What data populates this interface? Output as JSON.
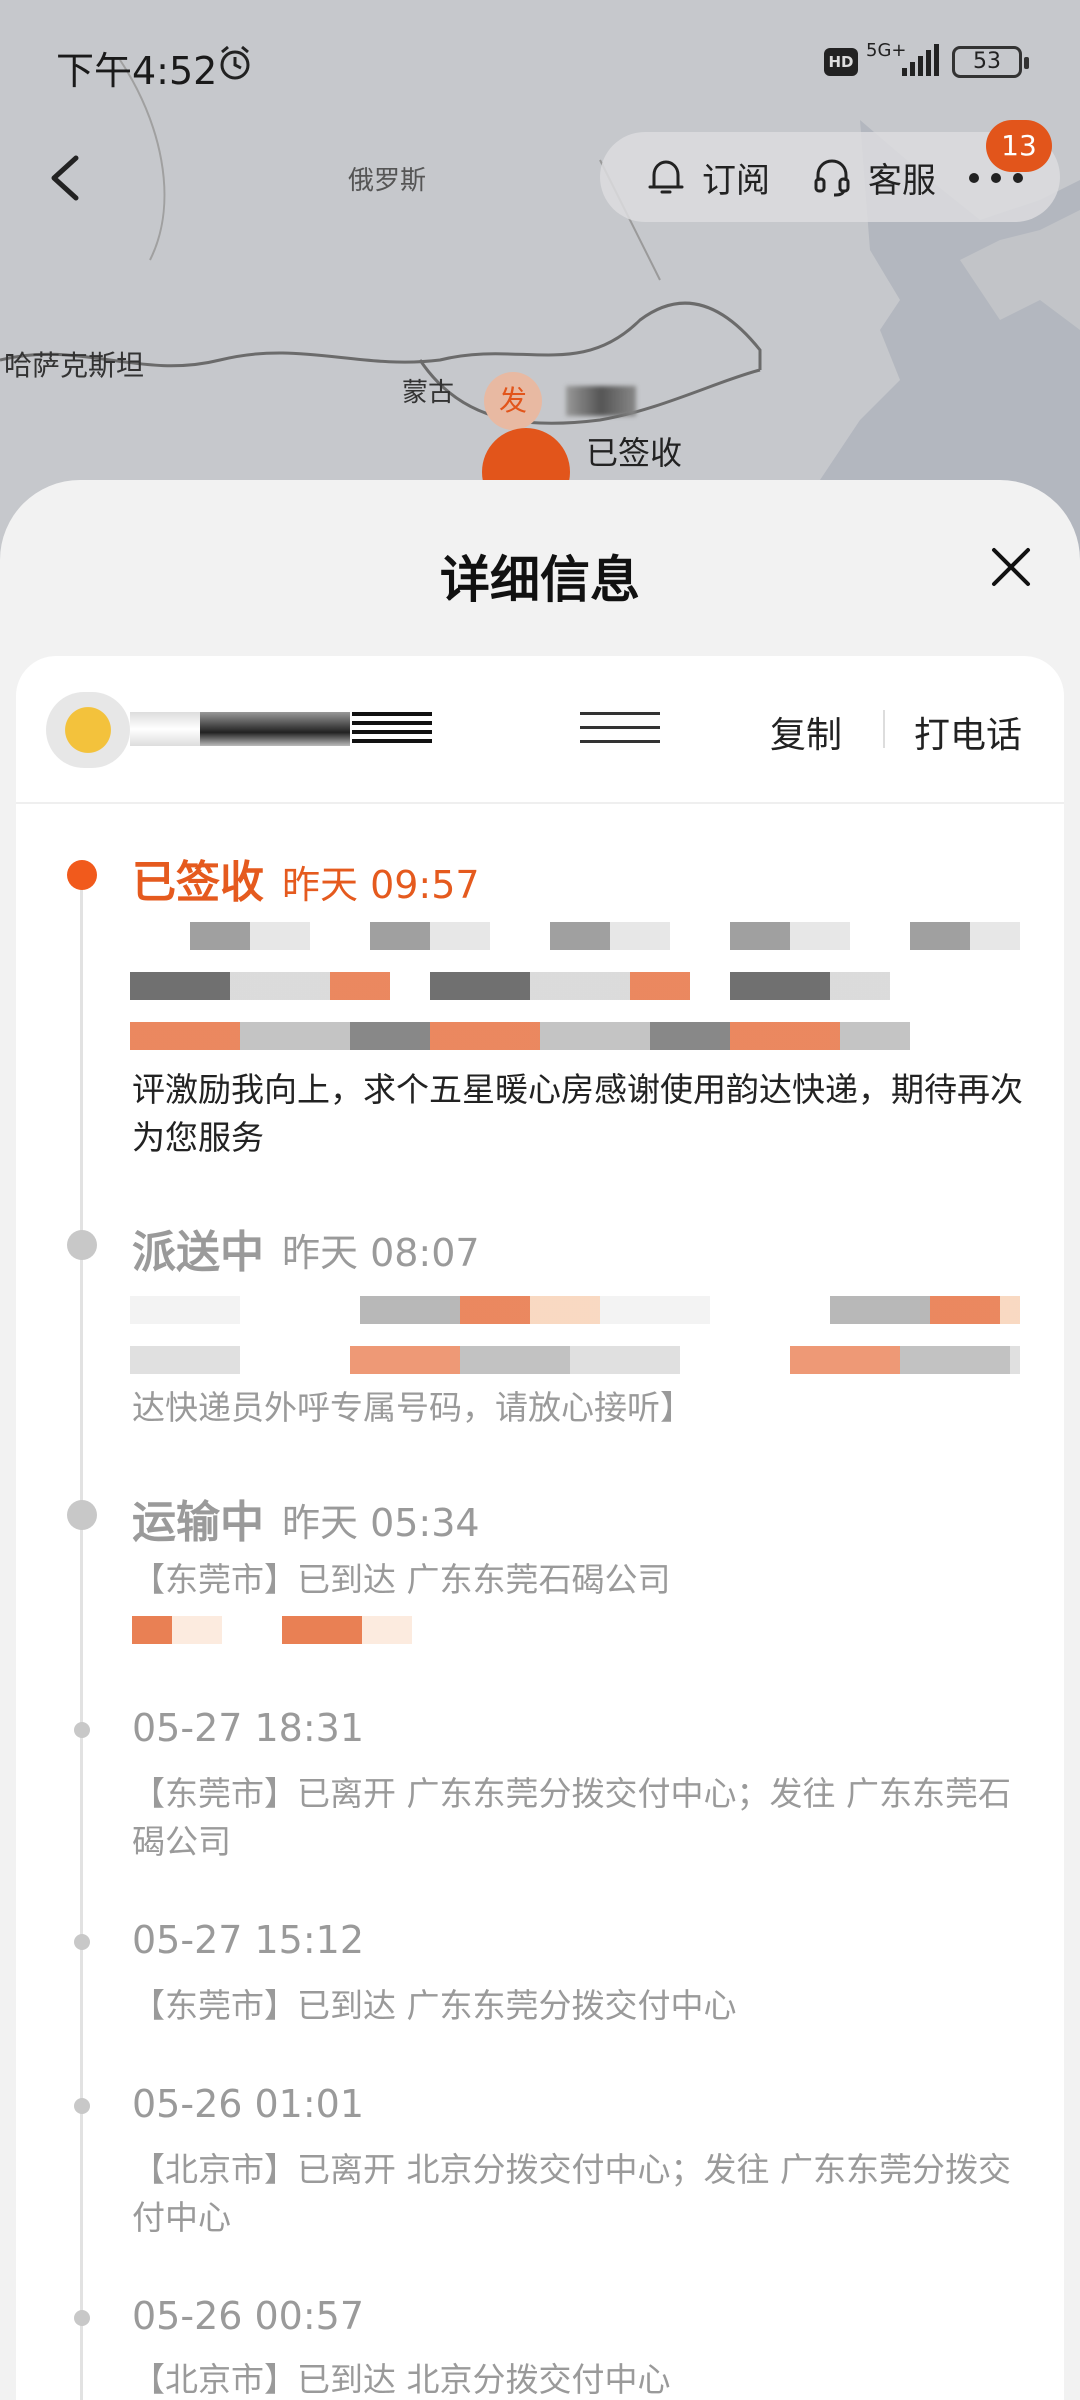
{
  "status_bar": {
    "time": "下午4:52",
    "hd": "HD",
    "network": "5G+",
    "battery": "53"
  },
  "map": {
    "labels": {
      "russia": "俄罗斯",
      "kazakhstan": "哈萨克斯坦",
      "mongolia": "蒙古"
    },
    "origin_marker": "发",
    "current_marker_label": "已签收"
  },
  "top_actions": {
    "subscribe": "订阅",
    "service": "客服",
    "badge_count": "13"
  },
  "sheet": {
    "title": "详细信息"
  },
  "header": {
    "copy": "复制",
    "call": "打电话"
  },
  "events": [
    {
      "status": "已签收",
      "time": "昨天 09:57",
      "text": "评激励我向上，求个五星暖心房感谢使用韵达快递，期待再次为您服务"
    },
    {
      "status": "派送中",
      "time": "昨天 08:07",
      "text": "达快递员外呼专属号码，请放心接听】"
    },
    {
      "status": "运输中",
      "time": "昨天 05:34",
      "text": "【东莞市】已到达 广东东莞石碣公司"
    },
    {
      "date": "05-27 18:31",
      "text": "【东莞市】已离开 广东东莞分拨交付中心；发往 广东东莞石碣公司"
    },
    {
      "date": "05-27 15:12",
      "text": "【东莞市】已到达 广东东莞分拨交付中心"
    },
    {
      "date": "05-26 01:01",
      "text": "【北京市】已离开 北京分拨交付中心；发往 广东东莞分拨交付中心"
    },
    {
      "date": "05-26 00:57",
      "text": "【北京市】已到达 北京分拨交付中心"
    }
  ],
  "colors": {
    "accent": "#e55a1e",
    "muted": "#9a9a9a"
  }
}
